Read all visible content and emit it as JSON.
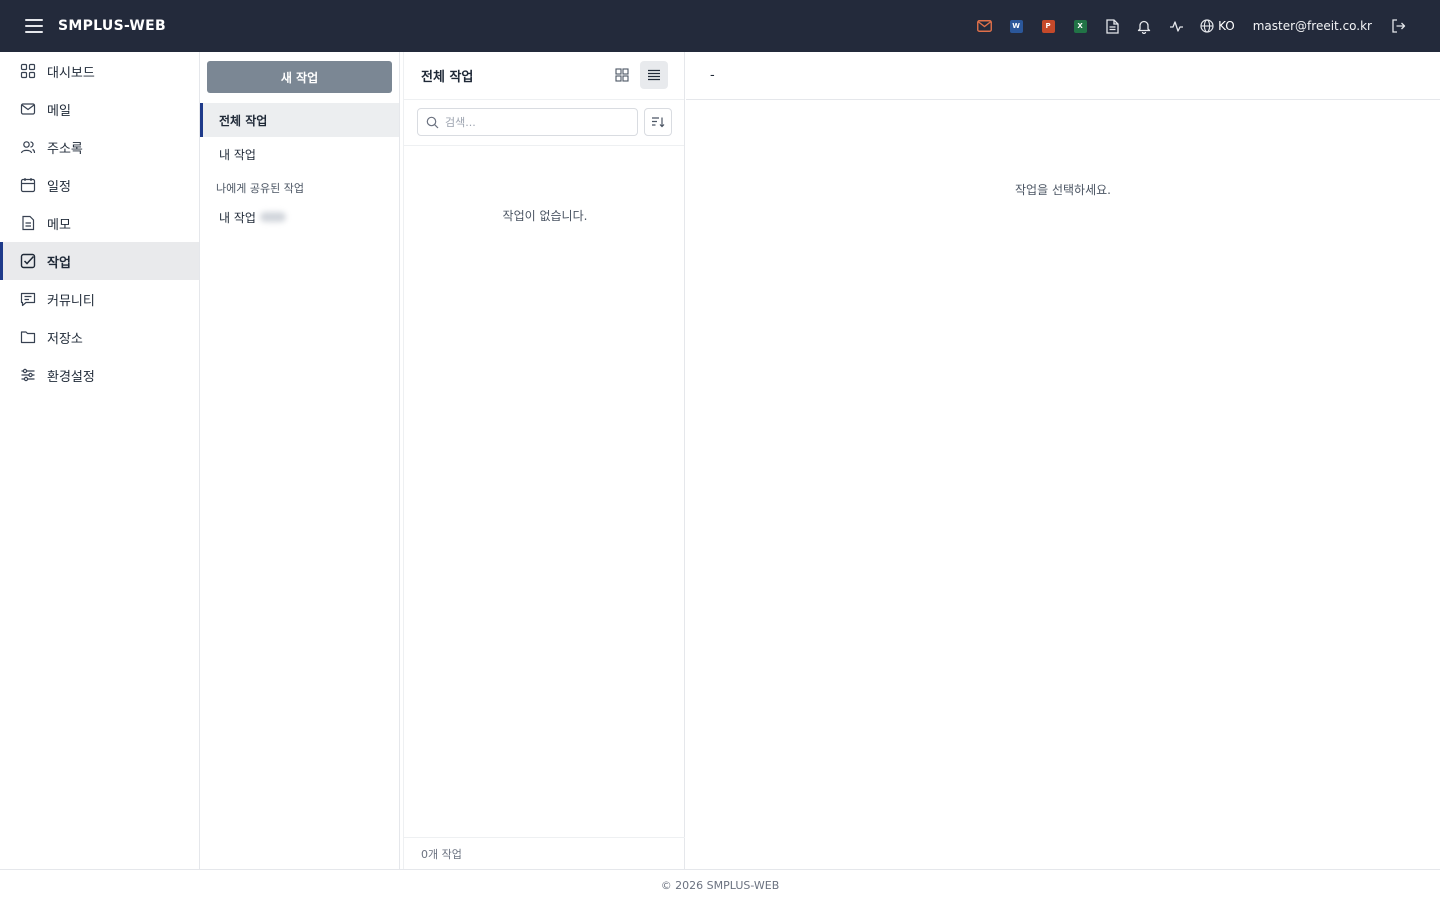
{
  "header": {
    "app_title": "SMPLUS-WEB",
    "icons": [
      "mail-icon",
      "word-icon",
      "powerpoint-icon",
      "excel-icon",
      "document-icon",
      "bell-icon",
      "activity-icon",
      "globe-icon"
    ],
    "word_badge": "W",
    "ppt_badge": "P",
    "excel_badge": "X",
    "language": "KO",
    "user_email": "master@freeit.co.kr",
    "colors": {
      "background": "#232a3b",
      "mail": "#e0704a",
      "word": "#2b579a",
      "powerpoint": "#c4492a",
      "excel": "#217346"
    }
  },
  "sidebar": {
    "active_index": 5,
    "accent": "#1e3a8a",
    "items": [
      {
        "label": "대시보드",
        "icon": "dashboard-icon"
      },
      {
        "label": "메일",
        "icon": "mail-icon"
      },
      {
        "label": "주소록",
        "icon": "contacts-icon"
      },
      {
        "label": "일정",
        "icon": "calendar-icon"
      },
      {
        "label": "메모",
        "icon": "memo-icon"
      },
      {
        "label": "작업",
        "icon": "task-icon"
      },
      {
        "label": "커뮤니티",
        "icon": "community-icon"
      },
      {
        "label": "저장소",
        "icon": "folder-icon"
      },
      {
        "label": "환경설정",
        "icon": "settings-sliders-icon"
      }
    ]
  },
  "subpanel": {
    "new_button": "새 작업",
    "items": [
      "전체 작업",
      "내 작업"
    ],
    "shared_section_title": "나에게 공유된 작업",
    "shared_items": [
      "내 작업"
    ]
  },
  "task_list": {
    "title": "전체 작업",
    "search_placeholder": "검색...",
    "empty_message": "작업이 없습니다.",
    "footer_count": "0개 작업"
  },
  "detail": {
    "title": "-",
    "empty_message": "작업을 선택하세요."
  },
  "footer": {
    "copyright": "© 2026 SMPLUS-WEB"
  }
}
